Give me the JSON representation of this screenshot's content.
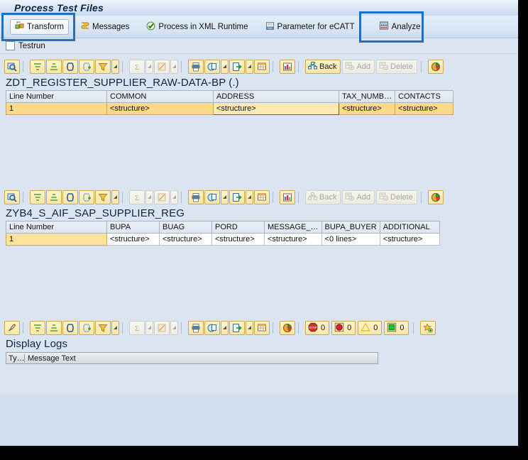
{
  "window": {
    "title": "Process Test Files"
  },
  "app_toolbar": {
    "buttons": [
      {
        "label": "Transform",
        "icon": "transform-icon",
        "highlighted": true,
        "raised": true
      },
      {
        "label": "Messages",
        "icon": "messages-scroll-icon",
        "highlighted": false,
        "raised": false
      },
      {
        "label": "Process in XML Runtime",
        "icon": "process-xml-runtime-icon",
        "highlighted": false,
        "raised": false
      },
      {
        "label": "Parameter for eCATT",
        "icon": "ecatt-parameter-icon",
        "highlighted": false,
        "raised": false
      },
      {
        "label": "Analyze",
        "icon": "analyze-icon",
        "highlighted": true,
        "raised": false
      }
    ]
  },
  "options": {
    "testrun_label": "Testrun",
    "testrun_checked": false
  },
  "grid_toolbar_1": {
    "icons": [
      "detail-magnifier-icon",
      "sort-ascending-icon",
      "sort-descending-icon",
      "find-icon",
      "find-next-icon",
      "filter-icon",
      "filter-dropdown-icon",
      "total-sum-icon",
      "total-dropdown-icon",
      "subtotal-icon",
      "subtotal-dropdown-icon",
      "print-icon",
      "export-local-file-icon",
      "export-dropdown-icon",
      "send-icon",
      "send-dropdown-icon",
      "layout-grid-icon",
      "graphic-chart-icon"
    ],
    "back_label": "Back",
    "add_label": "Add",
    "delete_label": "Delete",
    "back_enabled": true,
    "add_enabled": false,
    "delete_enabled": false,
    "pie_icon": "abc-pie-icon"
  },
  "grid_toolbar_2": {
    "back_label": "Back",
    "add_label": "Add",
    "delete_label": "Delete",
    "back_enabled": false,
    "add_enabled": false,
    "delete_enabled": false
  },
  "table1": {
    "title": "ZDT_REGISTER_SUPPLIER_RAW-DATA-BP (.)",
    "columns": [
      "Line Number",
      "COMMON",
      "ADDRESS",
      "TAX_NUMB…",
      "CONTACTS"
    ],
    "rows": [
      [
        "1",
        "<structure>",
        "<structure>",
        "<structure>",
        "<structure>"
      ]
    ],
    "selected_cell": {
      "row": 0,
      "col": 2
    }
  },
  "table2": {
    "title": "ZYB4_S_AIF_SAP_SUPPLIER_REG",
    "columns": [
      "Line Number",
      "BUPA",
      "BUAG",
      "PORD",
      "MESSAGE_…",
      "BUPA_BUYER",
      "ADDITIONAL"
    ],
    "rows": [
      [
        "1",
        "<structure>",
        "<structure>",
        "<structure>",
        "<structure>",
        "<0 lines>",
        "<structure>"
      ]
    ]
  },
  "log_toolbar": {
    "icons": [
      "edit-pencil-icon",
      "sort-ascending-icon",
      "sort-descending-icon",
      "find-icon",
      "find-next-icon",
      "filter-icon",
      "filter-dropdown-icon",
      "total-sum-icon",
      "total-dropdown-icon",
      "subtotal-icon",
      "subtotal-dropdown-icon",
      "print-icon",
      "export-local-file-icon",
      "export-dropdown-icon",
      "send-icon",
      "send-dropdown-icon",
      "layout-grid-icon",
      "abc-pie-icon",
      "favorite-add-icon"
    ],
    "status_counters": [
      {
        "name": "abort-stop-count",
        "icon": "stop-octagon-icon",
        "value": "0",
        "color": "#d0322b"
      },
      {
        "name": "error-count",
        "icon": "error-circle-icon",
        "value": "0",
        "color": "#e02020"
      },
      {
        "name": "warning-count",
        "icon": "warning-triangle-icon",
        "value": "0",
        "color": "#e8c400"
      },
      {
        "name": "success-count",
        "icon": "success-square-icon",
        "value": "0",
        "color": "#22c022"
      }
    ]
  },
  "logs": {
    "title": "Display Logs",
    "columns": [
      "Ty…",
      "Message Text"
    ],
    "rows": []
  },
  "colors": {
    "accent_highlight": "#1f6fc4",
    "selection_border": "#d0322b",
    "row_fill": "#ffd98a",
    "panel_bg": "#dbe5f2"
  }
}
